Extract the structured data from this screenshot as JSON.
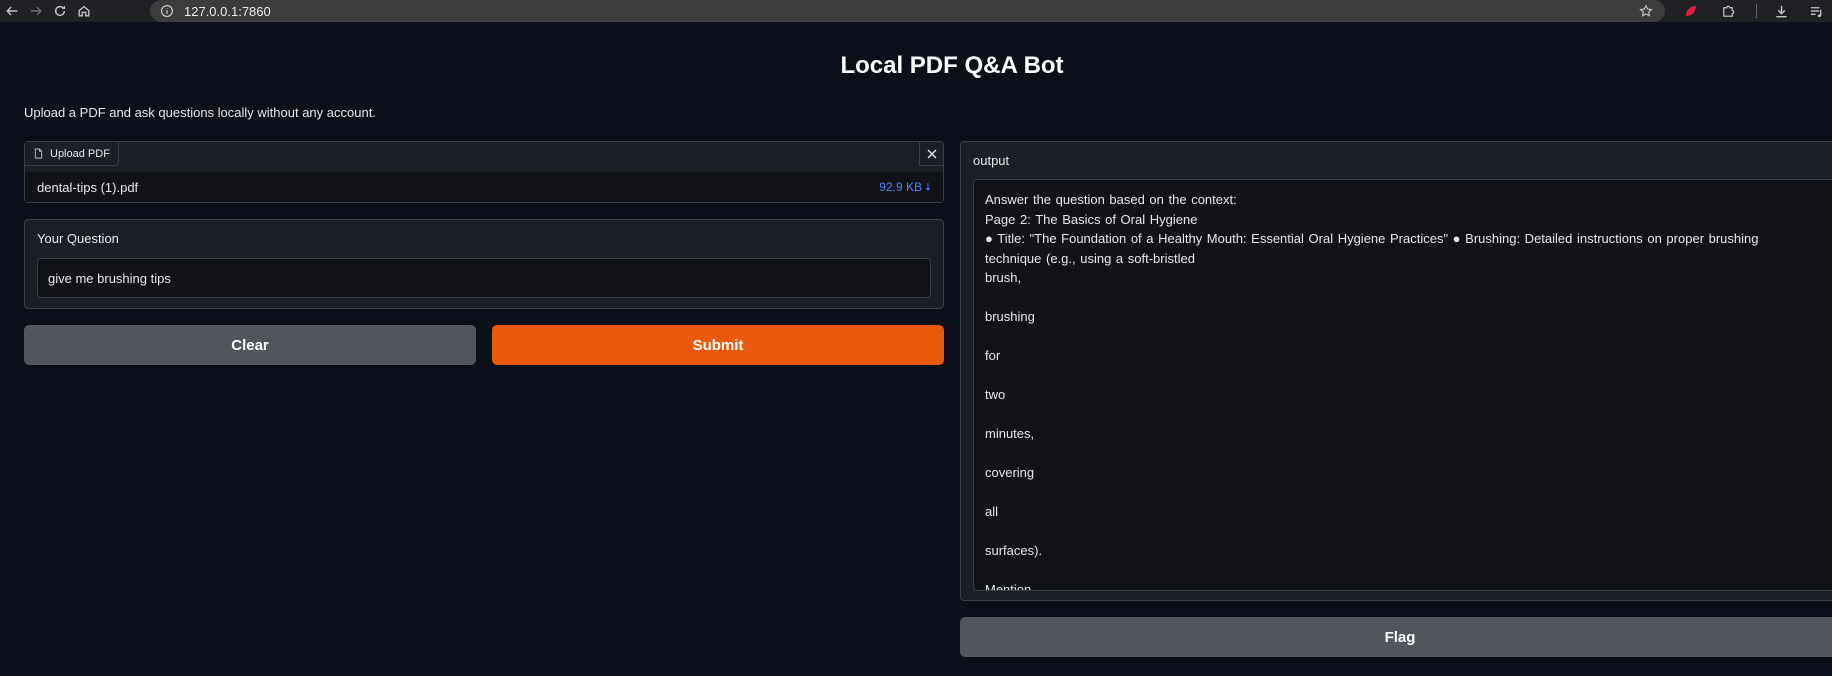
{
  "browser": {
    "url": "127.0.0.1:7860"
  },
  "app": {
    "title": "Local PDF Q&A Bot",
    "description": "Upload a PDF and ask questions locally without any account."
  },
  "upload": {
    "label": "Upload PDF",
    "file_name": "dental-tips (1).pdf",
    "file_size": "92.9 KB"
  },
  "question": {
    "label": "Your Question",
    "value": "give me brushing tips"
  },
  "buttons": {
    "clear": "Clear",
    "submit": "Submit",
    "flag": "Flag"
  },
  "output": {
    "label": "output",
    "lines": [
      "Answer the question based on the context:",
      "Page 2: The Basics of Oral Hygiene",
      "● Title: \"The Foundation of a Healthy Mouth: Essential Oral Hygiene Practices\" ● Brushing: Detailed instructions on proper brushing",
      "technique (e.g., using a soft-bristled",
      "brush,",
      "",
      "brushing",
      "",
      "for",
      "",
      "two",
      "",
      "minutes,",
      "",
      "covering",
      "",
      "all",
      "",
      "surfaces).",
      "",
      "Mention"
    ]
  },
  "colors": {
    "background": "#0b0f19",
    "submit": "#ea580c",
    "secondary_button": "#52555e",
    "file_size_link": "#4b83ff"
  },
  "icons": [
    "back-arrow-icon",
    "forward-arrow-icon",
    "reload-icon",
    "home-icon",
    "info-icon",
    "star-icon",
    "extension-icon",
    "puzzle-icon",
    "download-icon",
    "playlist-icon",
    "file-icon",
    "close-icon",
    "download-arrow-icon"
  ]
}
